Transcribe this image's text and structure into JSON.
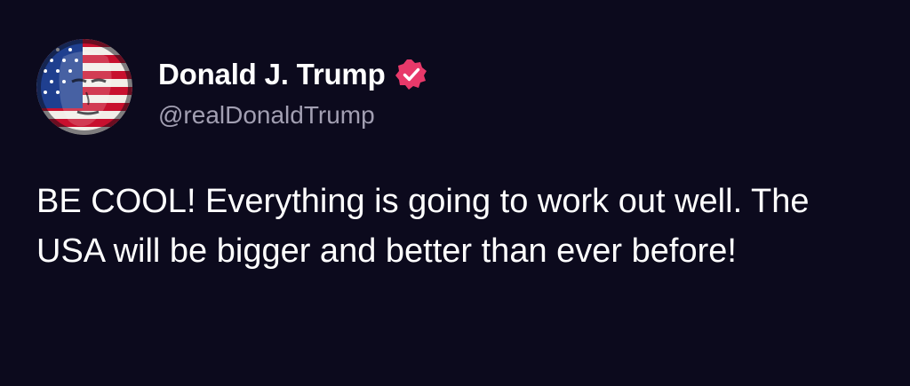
{
  "author": {
    "display_name": "Donald J. Trump",
    "handle": "@realDonaldTrump",
    "avatar_icon": "avatar-flag-portrait",
    "verified_icon": "verified-badge-icon",
    "verified_color": "#e8396a"
  },
  "post": {
    "text": "BE COOL! Everything is going to work out well. The USA will be bigger and better than ever before!"
  },
  "colors": {
    "background": "#0c0a1d",
    "name": "#ffffff",
    "handle": "#a29fb2",
    "body": "#ffffff"
  }
}
